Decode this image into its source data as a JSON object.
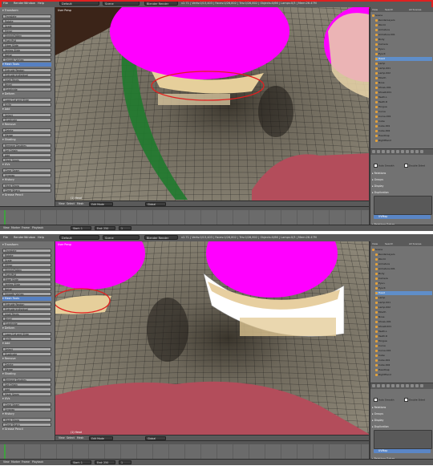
{
  "screenshots": [
    {
      "menu": [
        "File",
        "Render",
        "Window",
        "Help"
      ],
      "layout": "Default",
      "scene": "Scene",
      "engine": "Blender Render",
      "blend_info": "v2.71 | Verts:0/13,403 | Faces:0/26,802 | Tris:0/26,802 | Objects:0/66 | Lamps:0/3 | Mem:26.47M",
      "viewport_label": "User Persp",
      "object_label": "(1) Head",
      "highlight_color": "#e02020",
      "sphere_color": "#ff00ff",
      "outliner_tabs": [
        "View",
        "Search",
        "All Scenes"
      ],
      "outliner_rows": [
        "Scene",
        "RenderLayers",
        "World",
        "Armature",
        "Armature.001",
        "Body",
        "Camera",
        "Eye.L",
        "Eye.R",
        "Head",
        "Lamp",
        "Lamp.001",
        "Lamp.002",
        "Mouth",
        "Nose",
        "ShoeL.001",
        "ShoeR.001",
        "Teeth.L",
        "Teeth.R",
        "Tongue",
        "Curve",
        "Curve.001",
        "Cube",
        "Cube.001",
        "Cube.002",
        "HeadCap",
        "RightHand"
      ],
      "props_sections": [
        "Relations",
        "Groups",
        "Display",
        "Duplication",
        "Relations Extras",
        "Motion Paths",
        "Custom Properties"
      ],
      "props_checks": [
        "Auto Smooth",
        "Double Sided"
      ],
      "props_selected": "UVMap",
      "tool_buttons": [
        "Translate",
        "Rotate",
        "Scale",
        "Mirror",
        "Shrink/Fatten",
        "Push/Pull",
        "Edge Slide",
        "Vertex Slide",
        "Noise",
        "Smooth Vertex",
        "Extrude Region",
        "Extrude Individual",
        "Inset Faces",
        "Bevel",
        "Subdivide",
        "Loop Cut and Slide",
        "Knife",
        "Select",
        "Duplicate",
        "Delete",
        "Merge",
        "Remove Doubles",
        "Set Origin",
        "Add",
        "Mark Seam",
        "Clear Seam",
        "Unwrap",
        "Mark Sharp",
        "Clear Sharp"
      ],
      "tool_headers": [
        "Transform",
        "Mesh Tools",
        "Deform",
        "Add",
        "Remove",
        "Shading",
        "UVs",
        "History",
        "Grease Pencil"
      ],
      "viewport_header": [
        "View",
        "Select",
        "Mesh"
      ],
      "mode": "Edit Mode",
      "pivot": "Global",
      "timeline": [
        "View",
        "Marker",
        "Frame",
        "Playback"
      ],
      "start_label": "Start: 1",
      "end_label": "End: 250",
      "frame": "1",
      "sync": "No Sync"
    },
    {
      "menu": [
        "File",
        "Render",
        "Window",
        "Help"
      ],
      "layout": "Default",
      "scene": "Scene",
      "engine": "Blender Render",
      "blend_info": "v2.71 | Verts:0/13,403 | Faces:0/26,802 | Tris:0/26,802 | Objects:0/66 | Lamps:0/3 | Mem:26.47M",
      "viewport_label": "User Persp",
      "object_label": "(1) Head",
      "highlight_color": "#e02020",
      "sphere_color": "#ff00ff",
      "outliner_tabs": [
        "View",
        "Search",
        "All Scenes"
      ],
      "outliner_rows": [
        "Scene",
        "RenderLayers",
        "World",
        "Armature",
        "Armature.001",
        "Body",
        "Camera",
        "Eye.L",
        "Eye.R",
        "Head",
        "Lamp",
        "Lamp.001",
        "Lamp.002",
        "Mouth",
        "Nose",
        "ShoeL.001",
        "ShoeR.001",
        "Teeth.L",
        "Teeth.R",
        "Tongue",
        "Curve",
        "Curve.001",
        "Cube",
        "Cube.001",
        "Cube.002",
        "HeadCap",
        "RightHand"
      ],
      "props_sections": [
        "Relations",
        "Groups",
        "Display",
        "Duplication",
        "Relations Extras",
        "Motion Paths",
        "Custom Properties"
      ],
      "props_checks": [
        "Auto Smooth",
        "Double Sided"
      ],
      "props_selected": "UVMap",
      "tool_buttons": [
        "Translate",
        "Rotate",
        "Scale",
        "Mirror",
        "Shrink/Fatten",
        "Push/Pull",
        "Edge Slide",
        "Vertex Slide",
        "Noise",
        "Smooth Vertex",
        "Extrude Region",
        "Extrude Individual",
        "Inset Faces",
        "Bevel",
        "Subdivide",
        "Loop Cut and Slide",
        "Knife",
        "Select",
        "Duplicate",
        "Delete",
        "Merge",
        "Remove Doubles",
        "Set Origin",
        "Add",
        "Mark Seam",
        "Clear Seam",
        "Unwrap",
        "Mark Sharp",
        "Clear Sharp"
      ],
      "tool_headers": [
        "Transform",
        "Mesh Tools",
        "Deform",
        "Add",
        "Remove",
        "Shading",
        "UVs",
        "History",
        "Grease Pencil"
      ],
      "viewport_header": [
        "View",
        "Select",
        "Mesh"
      ],
      "mode": "Edit Mode",
      "pivot": "Global",
      "timeline": [
        "View",
        "Marker",
        "Frame",
        "Playback"
      ],
      "start_label": "Start: 1",
      "end_label": "End: 250",
      "frame": "1",
      "sync": "No Sync"
    }
  ]
}
